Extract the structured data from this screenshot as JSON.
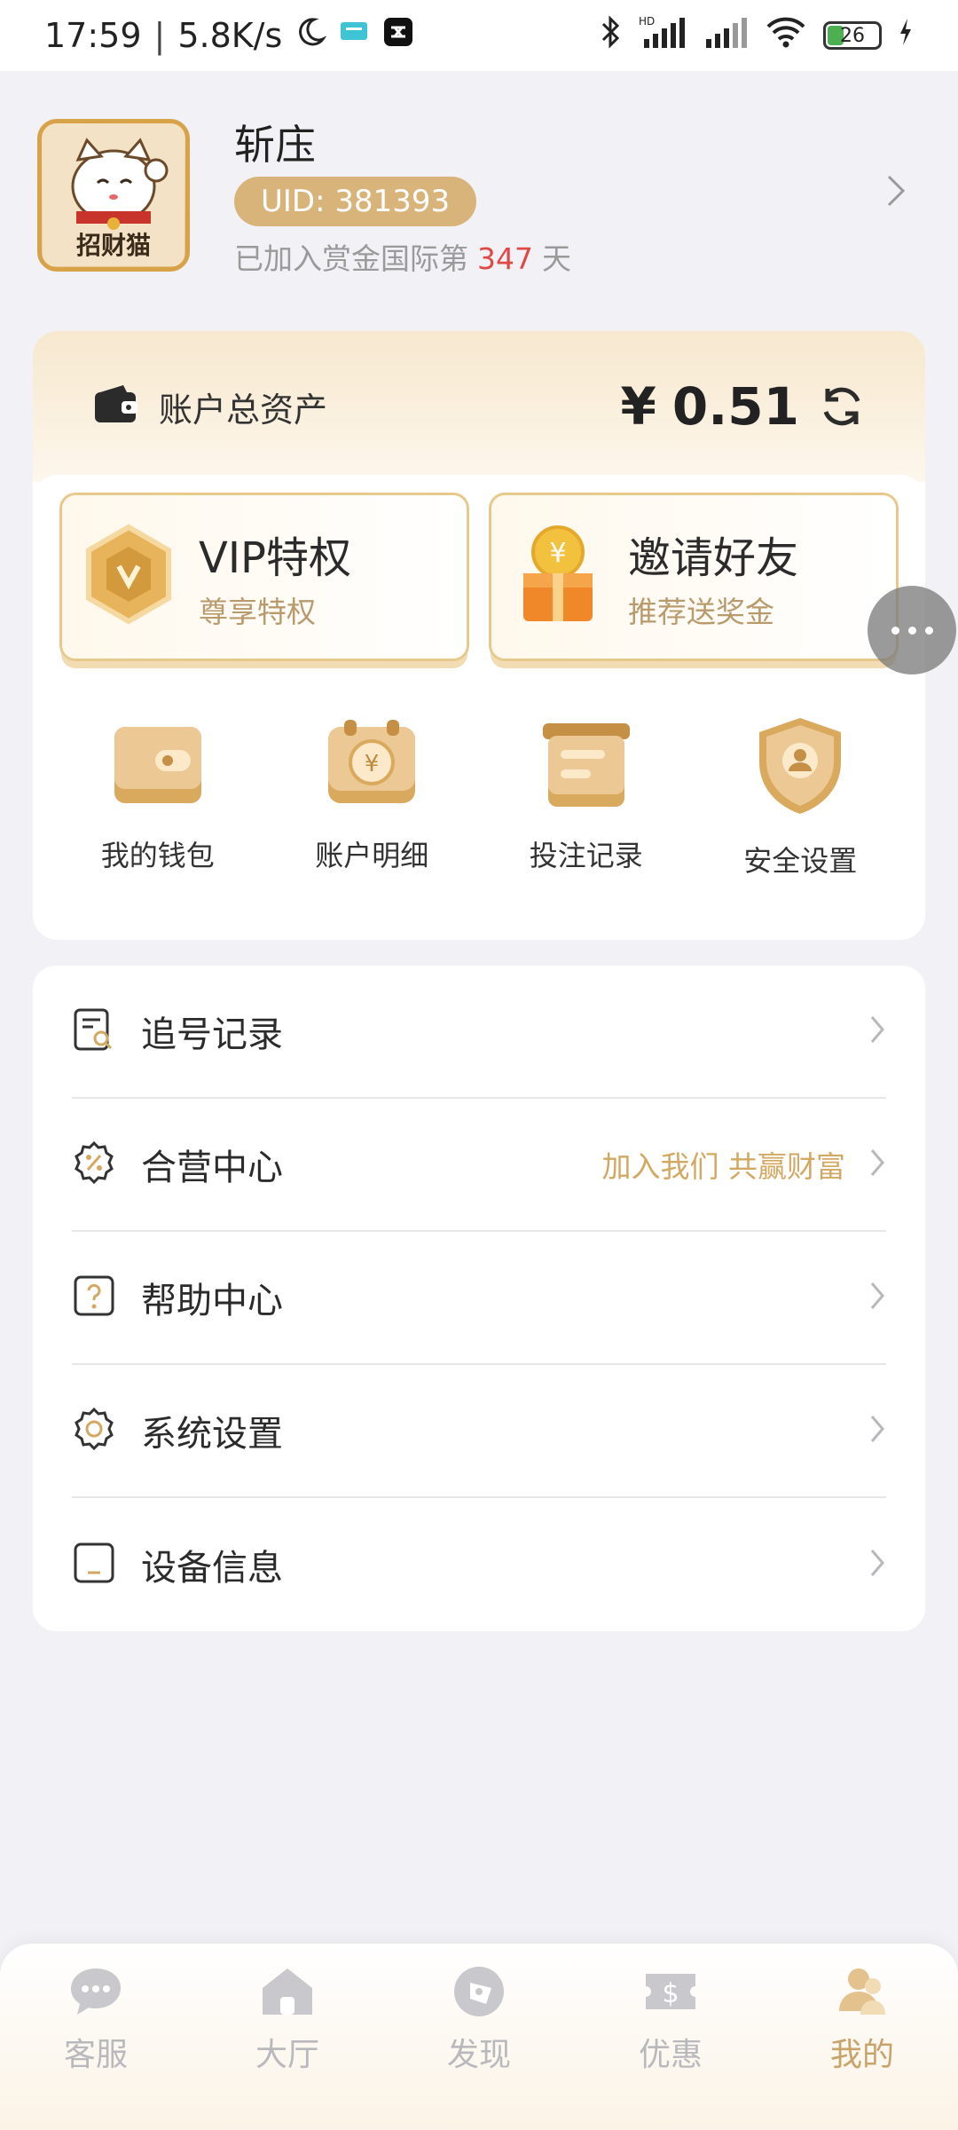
{
  "status_bar": {
    "time": "17:59",
    "speed": "5.8K/s",
    "battery": "26",
    "network": "HD"
  },
  "profile": {
    "name": "斩庒",
    "uid": "UID: 381393",
    "joined_prefix": "已加入赏金国际第",
    "joined_days": "347",
    "joined_suffix": "天",
    "avatar_text": "招财猫"
  },
  "assets": {
    "label": "账户总资产",
    "currency": "¥",
    "amount": "0.51"
  },
  "promos": [
    {
      "title": "VIP特权",
      "subtitle": "尊享特权",
      "icon": "vip-badge-icon"
    },
    {
      "title": "邀请好友",
      "subtitle": "推荐送奖金",
      "icon": "gift-icon"
    }
  ],
  "quick_links": [
    {
      "label": "我的钱包",
      "icon": "wallet-icon"
    },
    {
      "label": "账户明细",
      "icon": "bill-icon"
    },
    {
      "label": "投注记录",
      "icon": "record-icon"
    },
    {
      "label": "安全设置",
      "icon": "shield-icon"
    }
  ],
  "menu": [
    {
      "label": "追号记录",
      "extra": "",
      "icon": "search-doc-icon"
    },
    {
      "label": "合营中心",
      "extra": "加入我们 共赢财富",
      "icon": "percent-icon"
    },
    {
      "label": "帮助中心",
      "extra": "",
      "icon": "help-icon"
    },
    {
      "label": "系统设置",
      "extra": "",
      "icon": "gear-icon"
    },
    {
      "label": "设备信息",
      "extra": "",
      "icon": "device-icon"
    }
  ],
  "tabs": [
    {
      "label": "客服",
      "icon": "chat-icon",
      "active": false
    },
    {
      "label": "大厅",
      "icon": "home-icon",
      "active": false
    },
    {
      "label": "发现",
      "icon": "compass-icon",
      "active": false
    },
    {
      "label": "优惠",
      "icon": "coupon-icon",
      "active": false
    },
    {
      "label": "我的",
      "icon": "user-icon",
      "active": true
    }
  ],
  "colors": {
    "accent": "#d9b47a",
    "accent_text": "#d3a862",
    "highlight_red": "#e04848",
    "background": "#f2f2f6"
  }
}
